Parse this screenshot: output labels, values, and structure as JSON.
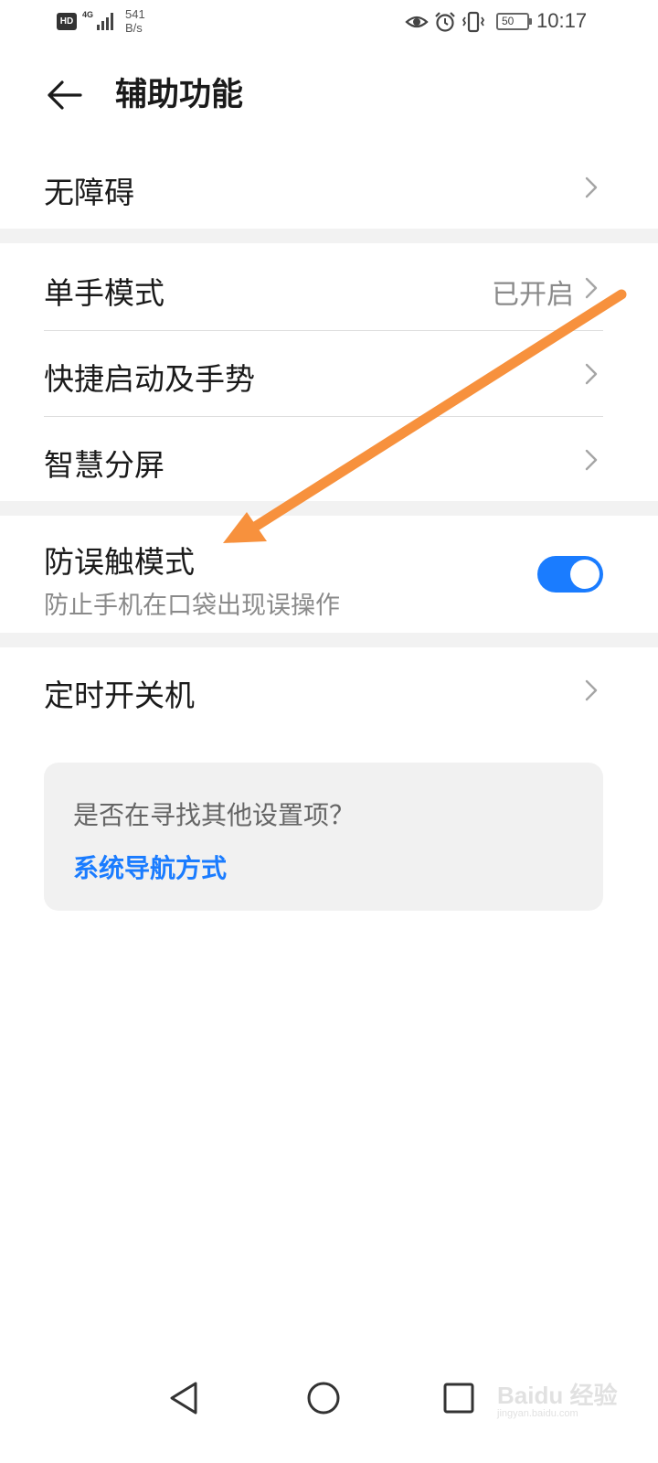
{
  "status_bar": {
    "hd": "HD",
    "network": "4G",
    "speed_value": "541",
    "speed_unit": "B/s",
    "battery": "50",
    "time": "10:17",
    "icons": [
      "eye-icon",
      "alarm-icon",
      "vibrate-icon"
    ]
  },
  "header": {
    "title": "辅助功能",
    "back_icon": "back-arrow-icon"
  },
  "items": {
    "accessibility": {
      "label": "无障碍"
    },
    "one_hand": {
      "label": "单手模式",
      "value": "已开启"
    },
    "shortcuts": {
      "label": "快捷启动及手势"
    },
    "split_screen": {
      "label": "智慧分屏"
    },
    "pocket_mode": {
      "label": "防误触模式",
      "description": "防止手机在口袋出现误操作",
      "enabled": true
    },
    "scheduled_power": {
      "label": "定时开关机"
    }
  },
  "suggestion_card": {
    "question": "是否在寻找其他设置项？",
    "link": "系统导航方式"
  },
  "watermark": {
    "text": "Baidu 经验",
    "sub": "jingyan.baidu.com"
  },
  "colors": {
    "accent": "#1a7cff",
    "annotation_arrow": "#f7913d",
    "section_gap": "#f2f2f2"
  }
}
